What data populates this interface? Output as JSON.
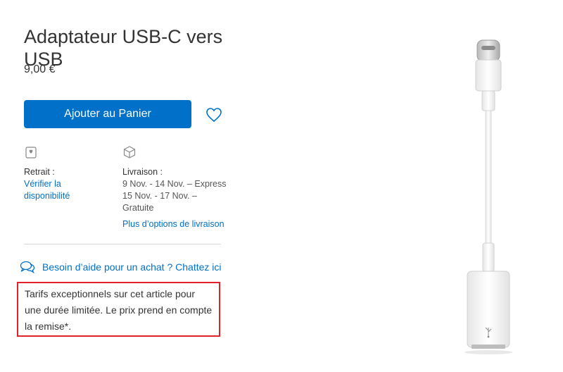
{
  "product": {
    "title": "Adaptateur USB-C vers USB",
    "price": "9,00 €",
    "image_name": "usb-c-to-usb-adapter-image"
  },
  "actions": {
    "add_to_cart": "Ajouter au Panier",
    "favorite_icon": "heart-icon"
  },
  "pickup": {
    "icon": "store-icon",
    "label": "Retrait :",
    "link": "Vérifier la disponibilité"
  },
  "delivery": {
    "icon": "box-icon",
    "label": "Livraison :",
    "lines": [
      "9 Nov. - 14 Nov. – Express",
      "15 Nov. - 17 Nov. – Gratuite"
    ],
    "more_link": "Plus d’options de livraison"
  },
  "help": {
    "icon": "chat-bubbles-icon",
    "text": "Besoin d’aide pour un achat ? Chattez ici"
  },
  "promo": {
    "text": "Tarifs exceptionnels sur cet article pour une durée limitée. Le prix prend en compte la remise*."
  },
  "colors": {
    "accent": "#0070c9",
    "highlight_border": "#e0222a"
  }
}
